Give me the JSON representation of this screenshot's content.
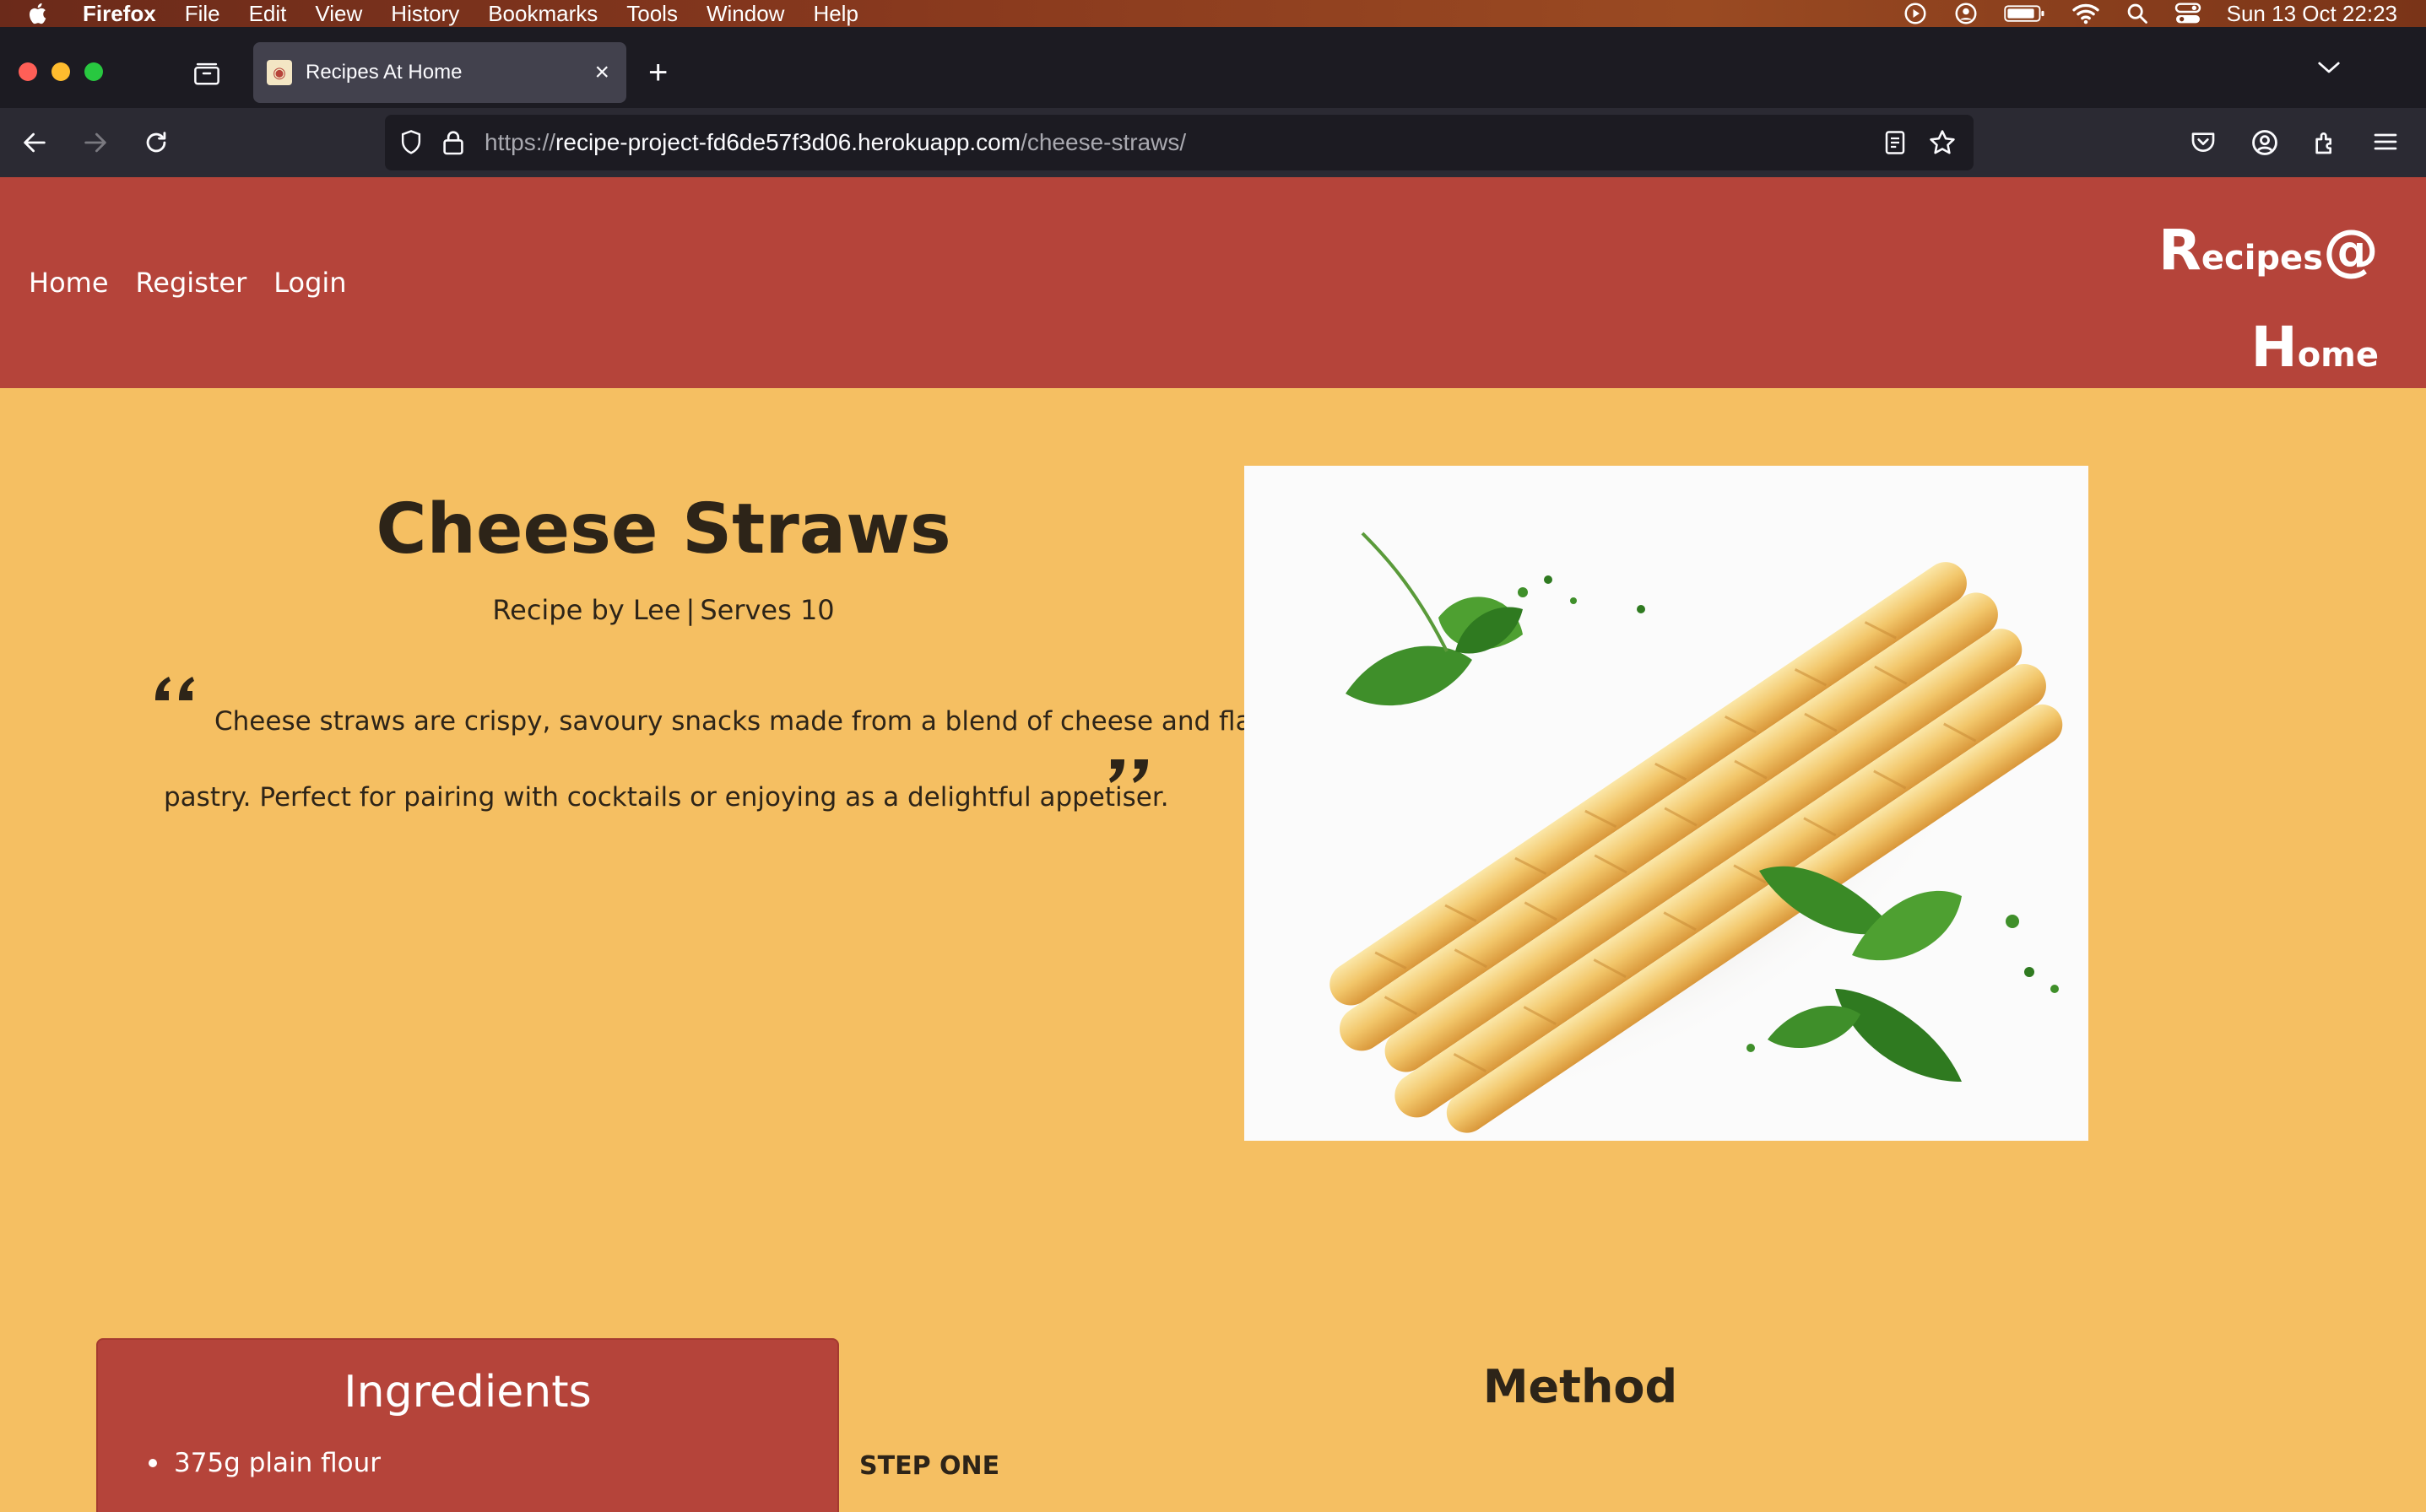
{
  "os_menubar": {
    "app_name": "Firefox",
    "menus": [
      "File",
      "Edit",
      "View",
      "History",
      "Bookmarks",
      "Tools",
      "Window",
      "Help"
    ],
    "clock": "Sun 13 Oct  22:23",
    "status_icons": [
      "play-circle-icon",
      "user-circle-icon",
      "battery-icon",
      "wifi-icon",
      "search-icon",
      "control-center-icon"
    ]
  },
  "browser": {
    "tab_title": "Recipes At Home",
    "url_prefix": "https://",
    "url_host": "recipe-project-fd6de57f3d06.herokuapp.com",
    "url_path": "/cheese-straws/"
  },
  "site": {
    "nav": [
      "Home",
      "Register",
      "Login"
    ],
    "brand": {
      "r_cap": "R",
      "r_rest": "ecipes",
      "at": "@",
      "h_cap": "H",
      "h_rest": "ome"
    },
    "colors": {
      "header_bg": "#b5443a",
      "page_bg": "#f5bf62",
      "text": "#2d2418"
    }
  },
  "recipe": {
    "title": "Cheese Straws",
    "author_text": "Recipe by Lee",
    "separator": "|",
    "serves_text": "Serves 10",
    "description_line1": "Cheese straws are crispy, savoury snacks made from a blend of cheese and flaky",
    "description_line2": "pastry. Perfect for pairing with cocktails or enjoying as a delightful appetiser.",
    "ingredients_heading": "Ingredients",
    "ingredients": [
      "375g plain flour"
    ],
    "method_heading": "Method",
    "step_one_label": "STEP ONE"
  }
}
